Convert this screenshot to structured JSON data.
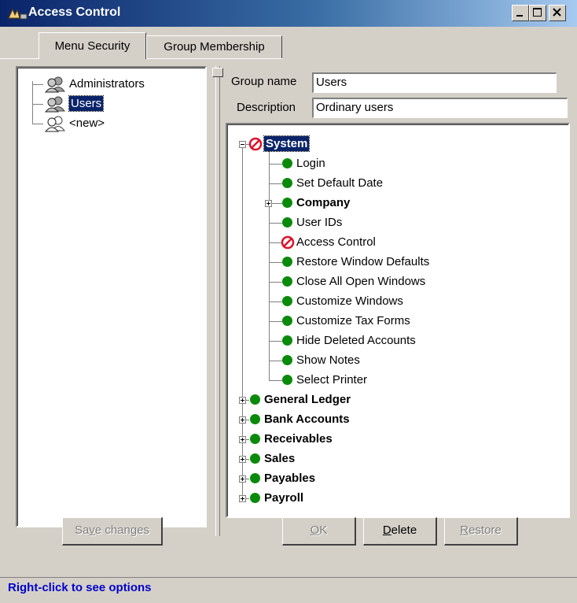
{
  "window": {
    "title": "Access Control",
    "controls": [
      "minimize-icon",
      "maximize-icon",
      "close-icon"
    ]
  },
  "tabs": [
    {
      "label": "Menu Security",
      "active": true
    },
    {
      "label": "Group Membership",
      "active": false
    }
  ],
  "groups": [
    {
      "label": "Administrators",
      "selected": false
    },
    {
      "label": "Users",
      "selected": true
    },
    {
      "label": "<new>",
      "selected": false
    }
  ],
  "form": {
    "group_name_label": "Group name",
    "group_name_value": "Users",
    "description_label": "Description",
    "description_value": "Ordinary users"
  },
  "menu_tree": {
    "root": {
      "label": "System",
      "status": "denied",
      "expanded": true,
      "selected": true
    },
    "system_children": [
      {
        "label": "Login",
        "status": "allowed"
      },
      {
        "label": "Set Default Date",
        "status": "allowed"
      },
      {
        "label": "Company",
        "status": "allowed",
        "bold": true,
        "expandable": true
      },
      {
        "label": "User IDs",
        "status": "allowed"
      },
      {
        "label": "Access Control",
        "status": "denied"
      },
      {
        "label": "Restore Window Defaults",
        "status": "allowed"
      },
      {
        "label": "Close All Open Windows",
        "status": "allowed"
      },
      {
        "label": "Customize Windows",
        "status": "allowed"
      },
      {
        "label": "Customize Tax Forms",
        "status": "allowed"
      },
      {
        "label": "Hide Deleted Accounts",
        "status": "allowed"
      },
      {
        "label": "Show Notes",
        "status": "allowed"
      },
      {
        "label": "Select Printer",
        "status": "allowed"
      }
    ],
    "top_level": [
      {
        "label": "General Ledger",
        "status": "allowed"
      },
      {
        "label": "Bank Accounts",
        "status": "allowed"
      },
      {
        "label": "Receivables",
        "status": "allowed"
      },
      {
        "label": "Sales",
        "status": "allowed"
      },
      {
        "label": "Payables",
        "status": "allowed"
      },
      {
        "label": "Payroll",
        "status": "allowed"
      }
    ]
  },
  "buttons": {
    "save_changes": "Save changes",
    "ok": "OK",
    "delete": "Delete",
    "restore": "Restore"
  },
  "status_bar": {
    "text": "Right-click to see options"
  },
  "colors": {
    "allowed": "#0a8a0a",
    "denied": "#e0102a",
    "selection": "#0a246a",
    "status_text": "#0000cc"
  }
}
